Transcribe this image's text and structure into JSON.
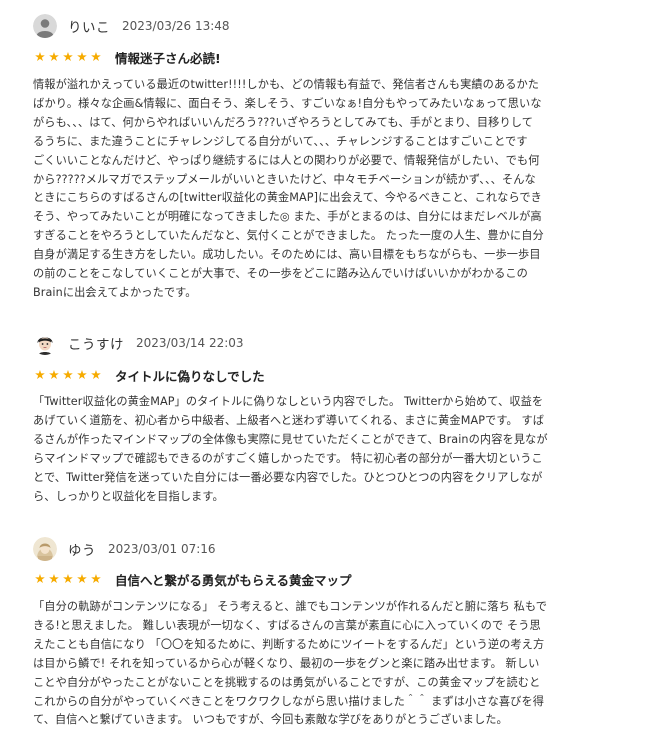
{
  "reviews": [
    {
      "user": "りいこ",
      "date": "2023/03/26 13:48",
      "rating": 5,
      "stars": "★★★★★",
      "title": "情報迷子さん必読!",
      "avatar_icon": "default-user-icon",
      "body": "情報が溢れかえっている最近のtwitter!!!!しかも、どの情報も有益で、発信者さんも実績のあるかた\nばかり。様々な企画&情報に、面白そう、楽しそう、すごいなぁ!自分もやってみたいなぁって思いな\nがらも、、、はて、何からやればいいんだろう???いざやろうとしてみても、手がとまり、目移りして\nるうちに、また違うことにチャレンジしてる自分がいて、、、チャレンジすることはすごいことです\nごくいいことなんだけど、やっぱり継続するには人との関わりが必要で、情報発信がしたい、でも何\nから?????メルマガでステップメールがいいときいたけど、中々モチベーションが続かず、、、そんな\nときにこちらのすばるさんの[twitter収益化の黄金MAP]に出会えて、今やるべきこと、これならでき\nそう、やってみたいことが明確になってきました◎ また、手がとまるのは、自分にはまだレベルが高\nすぎることをやろうとしていたんだなと、気付くことができました。 たった一度の人生、豊かに自分\n自身が満足する生き方をしたい。成功したい。そのためには、高い目標をもちながらも、一歩一歩目\nの前のことをこなしていくことが大事で、その一歩をどこに踏み込んでいけばいいかがわかるこの\nBrainに出会えてよかったです。"
    },
    {
      "user": "こうすけ",
      "date": "2023/03/14 22:03",
      "rating": 5,
      "stars": "★★★★★",
      "title": "タイトルに偽りなしでした",
      "avatar_icon": "illustrated-user-avatar",
      "body": "「Twitter収益化の黄金MAP」のタイトルに偽りなしという内容でした。 Twitterから始めて、収益を\nあげていく道筋を、初心者から中級者、上級者へと迷わず導いてくれる、まさに黄金MAPです。 すば\nるさんが作ったマインドマップの全体像も実際に見せていただくことができて、Brainの内容を見なが\nらマインドマップで確認もできるのがすごく嬉しかったです。 特に初心者の部分が一番大切というこ\nとで、Twitter発信を迷っていた自分には一番必要な内容でした。ひとつひとつの内容をクリアしなが\nら、しっかりと収益化を目指します。"
    },
    {
      "user": "ゆう",
      "date": "2023/03/01 07:16",
      "rating": 5,
      "stars": "★★★★★",
      "title": "自信へと繋がる勇気がもらえる黄金マップ",
      "avatar_icon": "photo-user-avatar",
      "body": "「自分の軌跡がコンテンツになる」 そう考えると、誰でもコンテンツが作れるんだと腑に落ち 私もで\nきる!と思えました。 難しい表現が一切なく、すばるさんの言葉が素直に心に入っていくので そう思\nえたことも自信になり 「〇〇を知るために、判断するためにツイートをするんだ」という逆の考え方\nは目から鱗で! それを知っているから心が軽くなり、最初の一歩をグンと楽に踏み出せます。 新しい\nことや自分がやったことがないことを挑戦するのは勇気がいることですが、この黄金マップを読むと\nこれからの自分がやっていくべきことをワクワクしながら思い描けました＾＾ まずは小さな喜びを得\nて、自信へと繋げていきます。 いつもですが、今回も素敵な学びをありがとうございました。"
    }
  ]
}
